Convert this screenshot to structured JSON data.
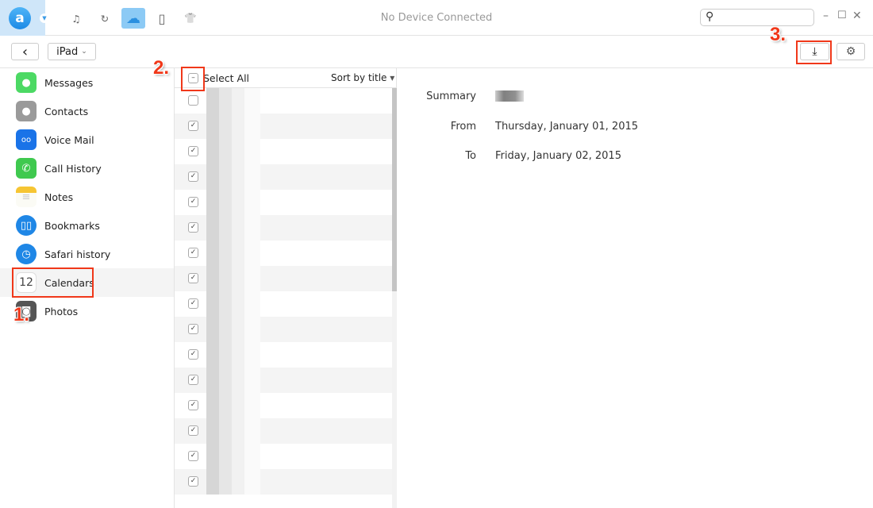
{
  "window": {
    "title": "No Device Connected",
    "search_placeholder": "",
    "controls": {
      "minimize": "–",
      "maximize": "☐",
      "close": "✕"
    }
  },
  "topnav": [
    {
      "name": "music-icon",
      "glyph": "♫"
    },
    {
      "name": "restore-icon",
      "glyph": "↻"
    },
    {
      "name": "icloud-icon",
      "glyph": "☁"
    },
    {
      "name": "phone-icon",
      "glyph": "▯"
    },
    {
      "name": "tshirt-icon",
      "glyph": "👕"
    }
  ],
  "toolbar": {
    "back_glyph": "‹",
    "device": "iPad",
    "device_caret": "⌄",
    "export_glyph": "⤓",
    "settings_glyph": "⚙"
  },
  "annotations": {
    "step1": "1.",
    "step2": "2.",
    "step3": "3."
  },
  "sidebar": {
    "items": [
      {
        "label": "Messages",
        "color": "#4cd964",
        "glyph": "💬"
      },
      {
        "label": "Contacts",
        "color": "#9a9a9a",
        "glyph": "👤"
      },
      {
        "label": "Voice Mail",
        "color": "#1a73e8",
        "glyph": "◯◯"
      },
      {
        "label": "Call History",
        "color": "#3fc94f",
        "glyph": "✆"
      },
      {
        "label": "Notes",
        "color": "#f6c533",
        "glyph": "≡"
      },
      {
        "label": "Bookmarks",
        "color": "#1f87e6",
        "glyph": "📖"
      },
      {
        "label": "Safari history",
        "color": "#1f87e6",
        "glyph": "◷"
      },
      {
        "label": "Calendars",
        "color": "#ffffff",
        "glyph": "12",
        "selected": true
      },
      {
        "label": "Photos",
        "color": "#555555",
        "glyph": "◙"
      }
    ]
  },
  "list": {
    "select_all": "Select All",
    "sort_label": "Sort by title",
    "sort_caret": "▾",
    "rows_checked": [
      false,
      true,
      true,
      true,
      true,
      true,
      true,
      true,
      true,
      true,
      true,
      true,
      true,
      true,
      true,
      true
    ]
  },
  "detail": {
    "fields": [
      {
        "label": "Summary",
        "value": ""
      },
      {
        "label": "From",
        "value": "Thursday, January 01, 2015"
      },
      {
        "label": "To",
        "value": "Friday, January 02, 2015"
      }
    ]
  }
}
